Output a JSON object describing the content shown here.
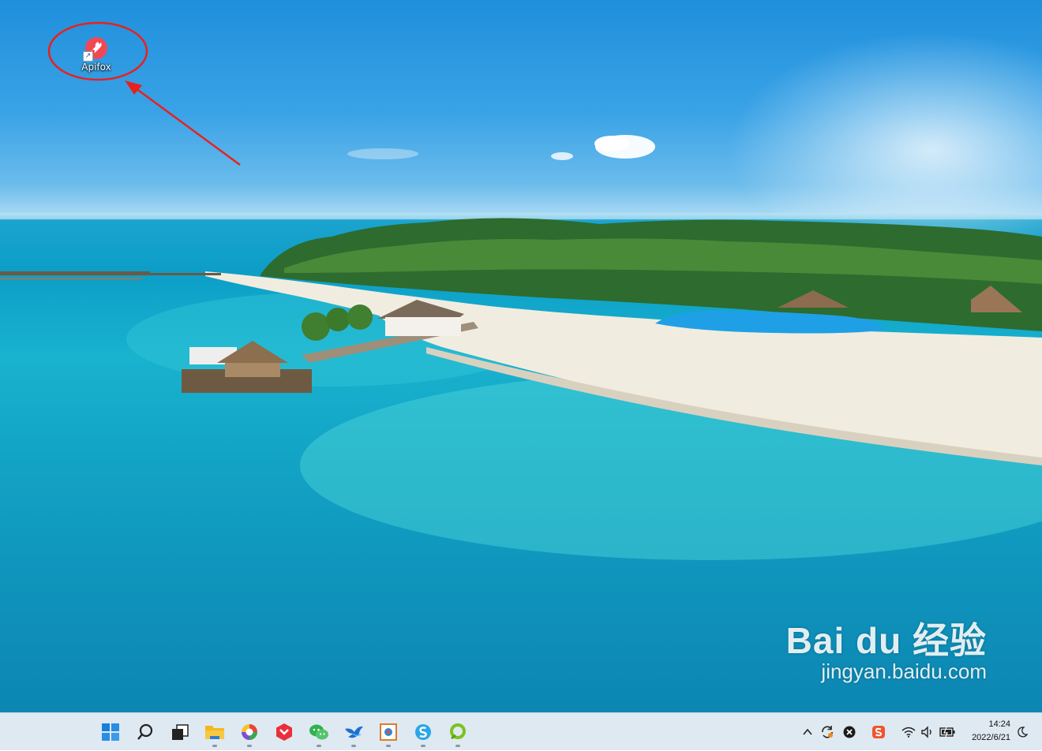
{
  "desktop": {
    "icons": [
      {
        "label": "Apifox",
        "icon": "apifox-app-icon"
      }
    ]
  },
  "watermark": {
    "brand": "Bai du 经验",
    "url": "jingyan.baidu.com"
  },
  "taskbar": {
    "apps": [
      {
        "name": "start",
        "icon": "windows-start-icon"
      },
      {
        "name": "search",
        "icon": "search-icon"
      },
      {
        "name": "task-view",
        "icon": "task-view-icon"
      },
      {
        "name": "file-explorer",
        "icon": "folder-icon"
      },
      {
        "name": "browser",
        "icon": "browser-icon"
      },
      {
        "name": "red-app",
        "icon": "red-hexagon-icon"
      },
      {
        "name": "wechat",
        "icon": "wechat-icon"
      },
      {
        "name": "bird-app",
        "icon": "bird-icon"
      },
      {
        "name": "photo-app",
        "icon": "photo-icon"
      },
      {
        "name": "s-app",
        "icon": "s-swirl-icon"
      },
      {
        "name": "green-app",
        "icon": "green-ring-icon"
      }
    ],
    "tray": {
      "icons": [
        "chevron-up-icon",
        "sync-icon",
        "close-circle-icon",
        "sogou-icon",
        "wifi-icon",
        "volume-icon",
        "battery-icon"
      ]
    },
    "clock": {
      "time": "14:24",
      "date": "2022/6/21"
    },
    "notification_icon": "moon-icon"
  },
  "colors": {
    "annotation": "#e8211e",
    "apifox_brand": "#f04955",
    "taskbar_bg": "#dfe9f2"
  }
}
